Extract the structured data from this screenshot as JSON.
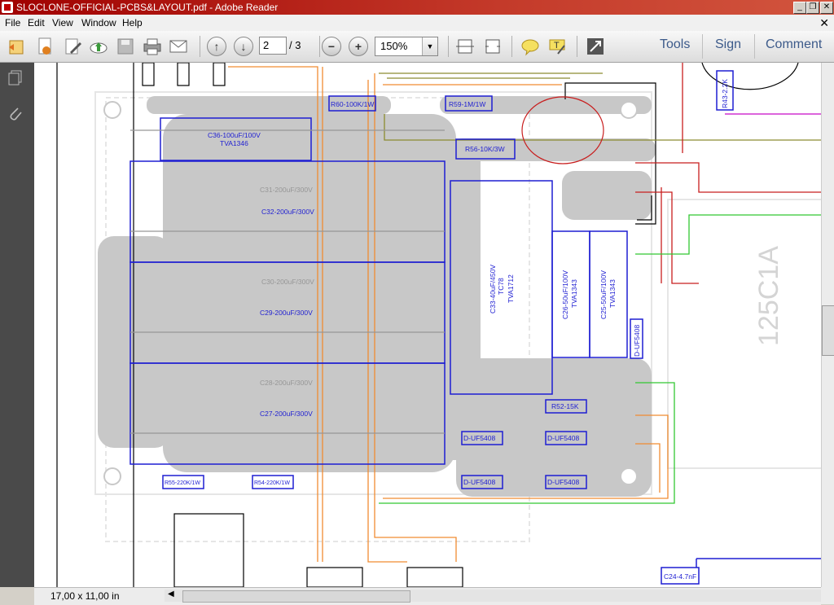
{
  "window": {
    "title": "SLOCLONE-OFFICIAL-PCBS&LAYOUT.pdf - Adobe Reader",
    "controls": [
      "_",
      "❐",
      "✕"
    ]
  },
  "menu": {
    "items": [
      "File",
      "Edit",
      "View",
      "Window",
      "Help"
    ],
    "close": "✕"
  },
  "toolbar": {
    "page_current": "2",
    "page_total": "/ 3",
    "zoom": "150%",
    "tools_label": "Tools",
    "sign_label": "Sign",
    "comment_label": "Comment"
  },
  "status": {
    "page_size": "17,00 x 11,00 in"
  },
  "pcb": {
    "labels": {
      "c36": "C36-100uF/100V",
      "c36_type": "TVA1346",
      "c31": "C31-200uF/300V",
      "c32": "C32-200uF/300V",
      "c30": "C30-200uF/300V",
      "c29": "C29-200uF/300V",
      "c28": "C28-200uF/300V",
      "c27": "C27-200uF/300V",
      "c33": "C33-40uF/450V",
      "c33_b": "TC78",
      "c33_type": "TVA1712",
      "c26": "C26-50uF/100V",
      "c26_type": "TVA1343",
      "c25": "C25-50uF/100V",
      "c25_type": "TVA1343",
      "d_right": "D-UF5408",
      "r60": "R60-100K/1W",
      "r59": "R59-1M/1W",
      "r56": "R56-10K/3W",
      "r52": "R52-15K",
      "d_a": "D-UF5408",
      "d_b": "D-UF5408",
      "d_c": "D-UF5408",
      "d_d": "D-UF5408",
      "r55": "R55-220K/1W",
      "r54": "R54-220K/1W",
      "r43": "R43-2.2K",
      "tube": "125C1A",
      "c24": "C24-4.7nF",
      "plus": "+",
      "minus": "-"
    }
  }
}
